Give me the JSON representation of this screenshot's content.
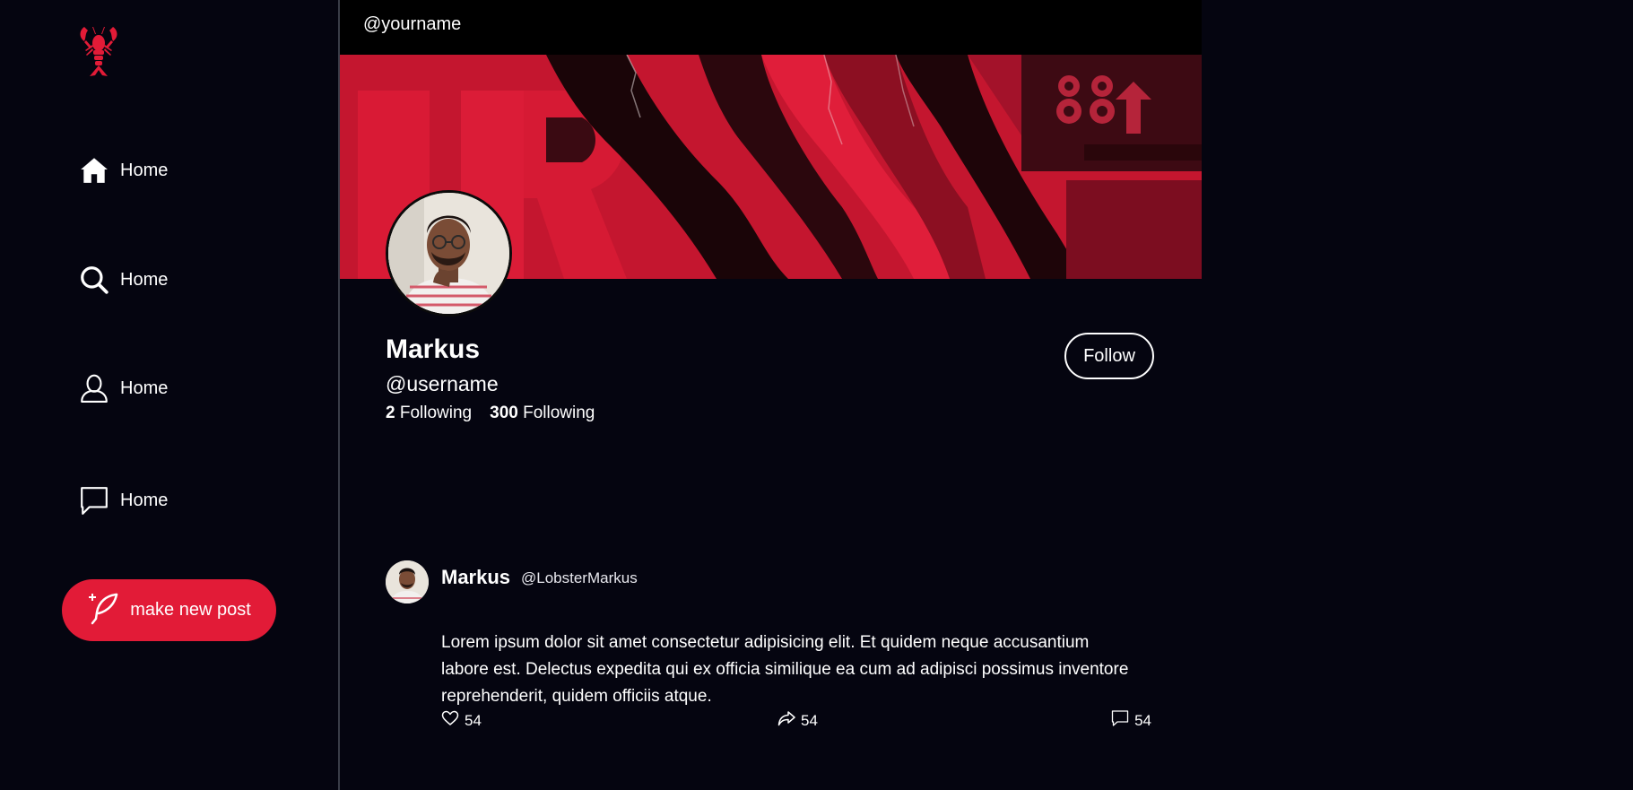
{
  "sidebar": {
    "logo_icon": "lobster-icon",
    "items": [
      {
        "label": "Home",
        "icon": "home-icon"
      },
      {
        "label": "Home",
        "icon": "search-icon"
      },
      {
        "label": "Home",
        "icon": "user-icon"
      },
      {
        "label": "Home",
        "icon": "message-icon"
      }
    ],
    "new_post": {
      "label": "make new post",
      "icon": "feather-icon"
    }
  },
  "topbar": {
    "handle": "@yourname"
  },
  "profile": {
    "name": "Markus",
    "handle": "@username",
    "stats": [
      {
        "count": "2",
        "label": "Following"
      },
      {
        "count": "300",
        "label": "Following"
      }
    ],
    "follow_label": "Follow"
  },
  "post": {
    "author": "Markus",
    "handle": "@LobsterMarkus",
    "body": "Lorem ipsum dolor sit amet consectetur adipisicing elit. Et quidem neque accusantium labore est. Delectus expedita qui ex officia similique ea cum ad adipisci possimus inventore reprehenderit, quidem officiis atque.",
    "likes": "54",
    "shares": "54",
    "comments": "54"
  },
  "colors": {
    "accent": "#e21b37",
    "background": "#050510",
    "topbar": "#000000",
    "divider": "#3a3d48"
  }
}
